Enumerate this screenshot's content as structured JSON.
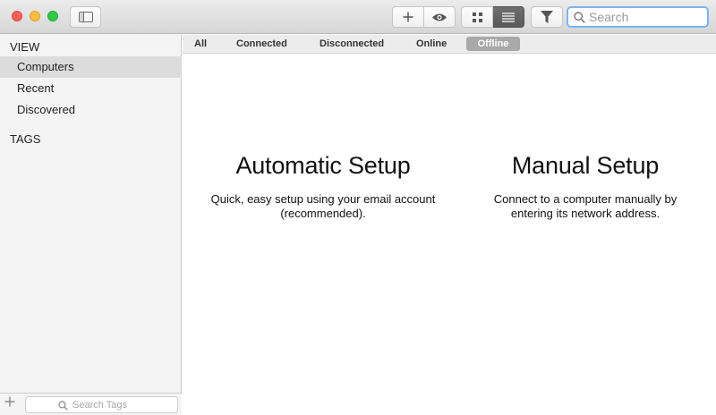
{
  "toolbar": {
    "add_icon": "plus-icon",
    "eye_icon": "eye-icon",
    "grid_icon": "grid-view-icon",
    "list_icon": "list-view-icon",
    "filter_icon": "funnel-icon",
    "search_placeholder": "Search"
  },
  "sidebar": {
    "view_heading": "VIEW",
    "items": [
      {
        "label": "Computers",
        "selected": true
      },
      {
        "label": "Recent",
        "selected": false
      },
      {
        "label": "Discovered",
        "selected": false
      }
    ],
    "tags_heading": "TAGS",
    "tag_search_placeholder": "Search Tags"
  },
  "filters": [
    {
      "label": "All",
      "active": false
    },
    {
      "label": "Connected",
      "active": false
    },
    {
      "label": "Disconnected",
      "active": false
    },
    {
      "label": "Online",
      "active": false
    },
    {
      "label": "Offline",
      "active": true
    }
  ],
  "main": {
    "automatic": {
      "title": "Automatic Setup",
      "description_line1": "Quick, easy setup using your email account",
      "description_line2": "(recommended)."
    },
    "manual": {
      "title": "Manual Setup",
      "description_line1": "Connect to a computer manually by",
      "description_line2": "entering its network address."
    }
  },
  "colors": {
    "accent_search_border": "#7fb3f2",
    "selected_row": "#dcdcdc",
    "active_filter": "#a9a9a9"
  }
}
